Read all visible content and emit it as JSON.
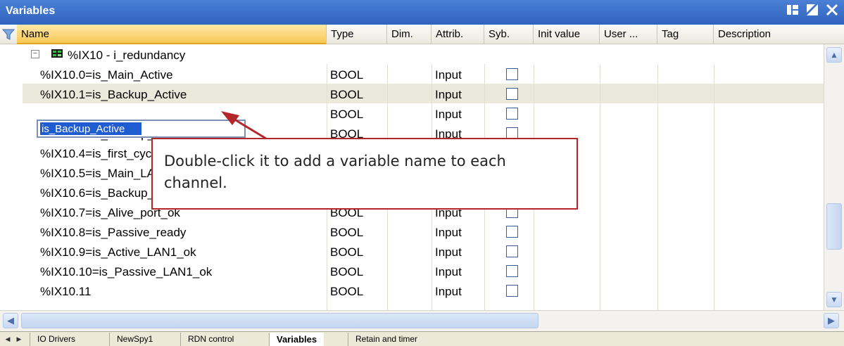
{
  "window": {
    "title": "Variables"
  },
  "columns": [
    "Name",
    "Type",
    "Dim.",
    "Attrib.",
    "Syb.",
    "Init value",
    "User ...",
    "Tag",
    "Description"
  ],
  "group": {
    "toggle": "−",
    "label": "%IX10 - i_redundancy"
  },
  "rows": [
    {
      "name": "%IX10.0=is_Main_Active",
      "type": "BOOL",
      "attrib": "Input"
    },
    {
      "name": "%IX10.1=is_Backup_Active",
      "type": "BOOL",
      "attrib": "Input"
    },
    {
      "name": "",
      "type": "BOOL",
      "attrib": "Input"
    },
    {
      "name": "%IX10.3=is_Backup_ready",
      "type": "BOOL",
      "attrib": "Input"
    },
    {
      "name": "%IX10.4=is_first_cycle_just_afte",
      "type": "BOOL",
      "attrib": "Input"
    },
    {
      "name": "%IX10.5=is_Main_LAN1_ok",
      "type": "BOOL",
      "attrib": "Input"
    },
    {
      "name": "%IX10.6=is_Backup_LAN1_ok",
      "type": "BOOL",
      "attrib": "Input"
    },
    {
      "name": "%IX10.7=is_Alive_port_ok",
      "type": "BOOL",
      "attrib": "Input"
    },
    {
      "name": "%IX10.8=is_Passive_ready",
      "type": "BOOL",
      "attrib": "Input"
    },
    {
      "name": "%IX10.9=is_Active_LAN1_ok",
      "type": "BOOL",
      "attrib": "Input"
    },
    {
      "name": "%IX10.10=is_Passive_LAN1_ok",
      "type": "BOOL",
      "attrib": "Input"
    },
    {
      "name": "%IX10.11",
      "type": "BOOL",
      "attrib": "Input"
    }
  ],
  "editor": {
    "value": "is_Backup_Active"
  },
  "callout": {
    "text": "Double-click it to add a variable name to each channel."
  },
  "tabs": [
    "IO Drivers",
    "NewSpy1",
    "RDN control",
    "Variables",
    "Retain and timer"
  ],
  "active_tab": "Variables",
  "colors": {
    "titlebar": "#2f63bf",
    "selected_row": "#ebe8dc",
    "callout_border": "#b3262a",
    "edit_selection": "#1f5bd1"
  }
}
